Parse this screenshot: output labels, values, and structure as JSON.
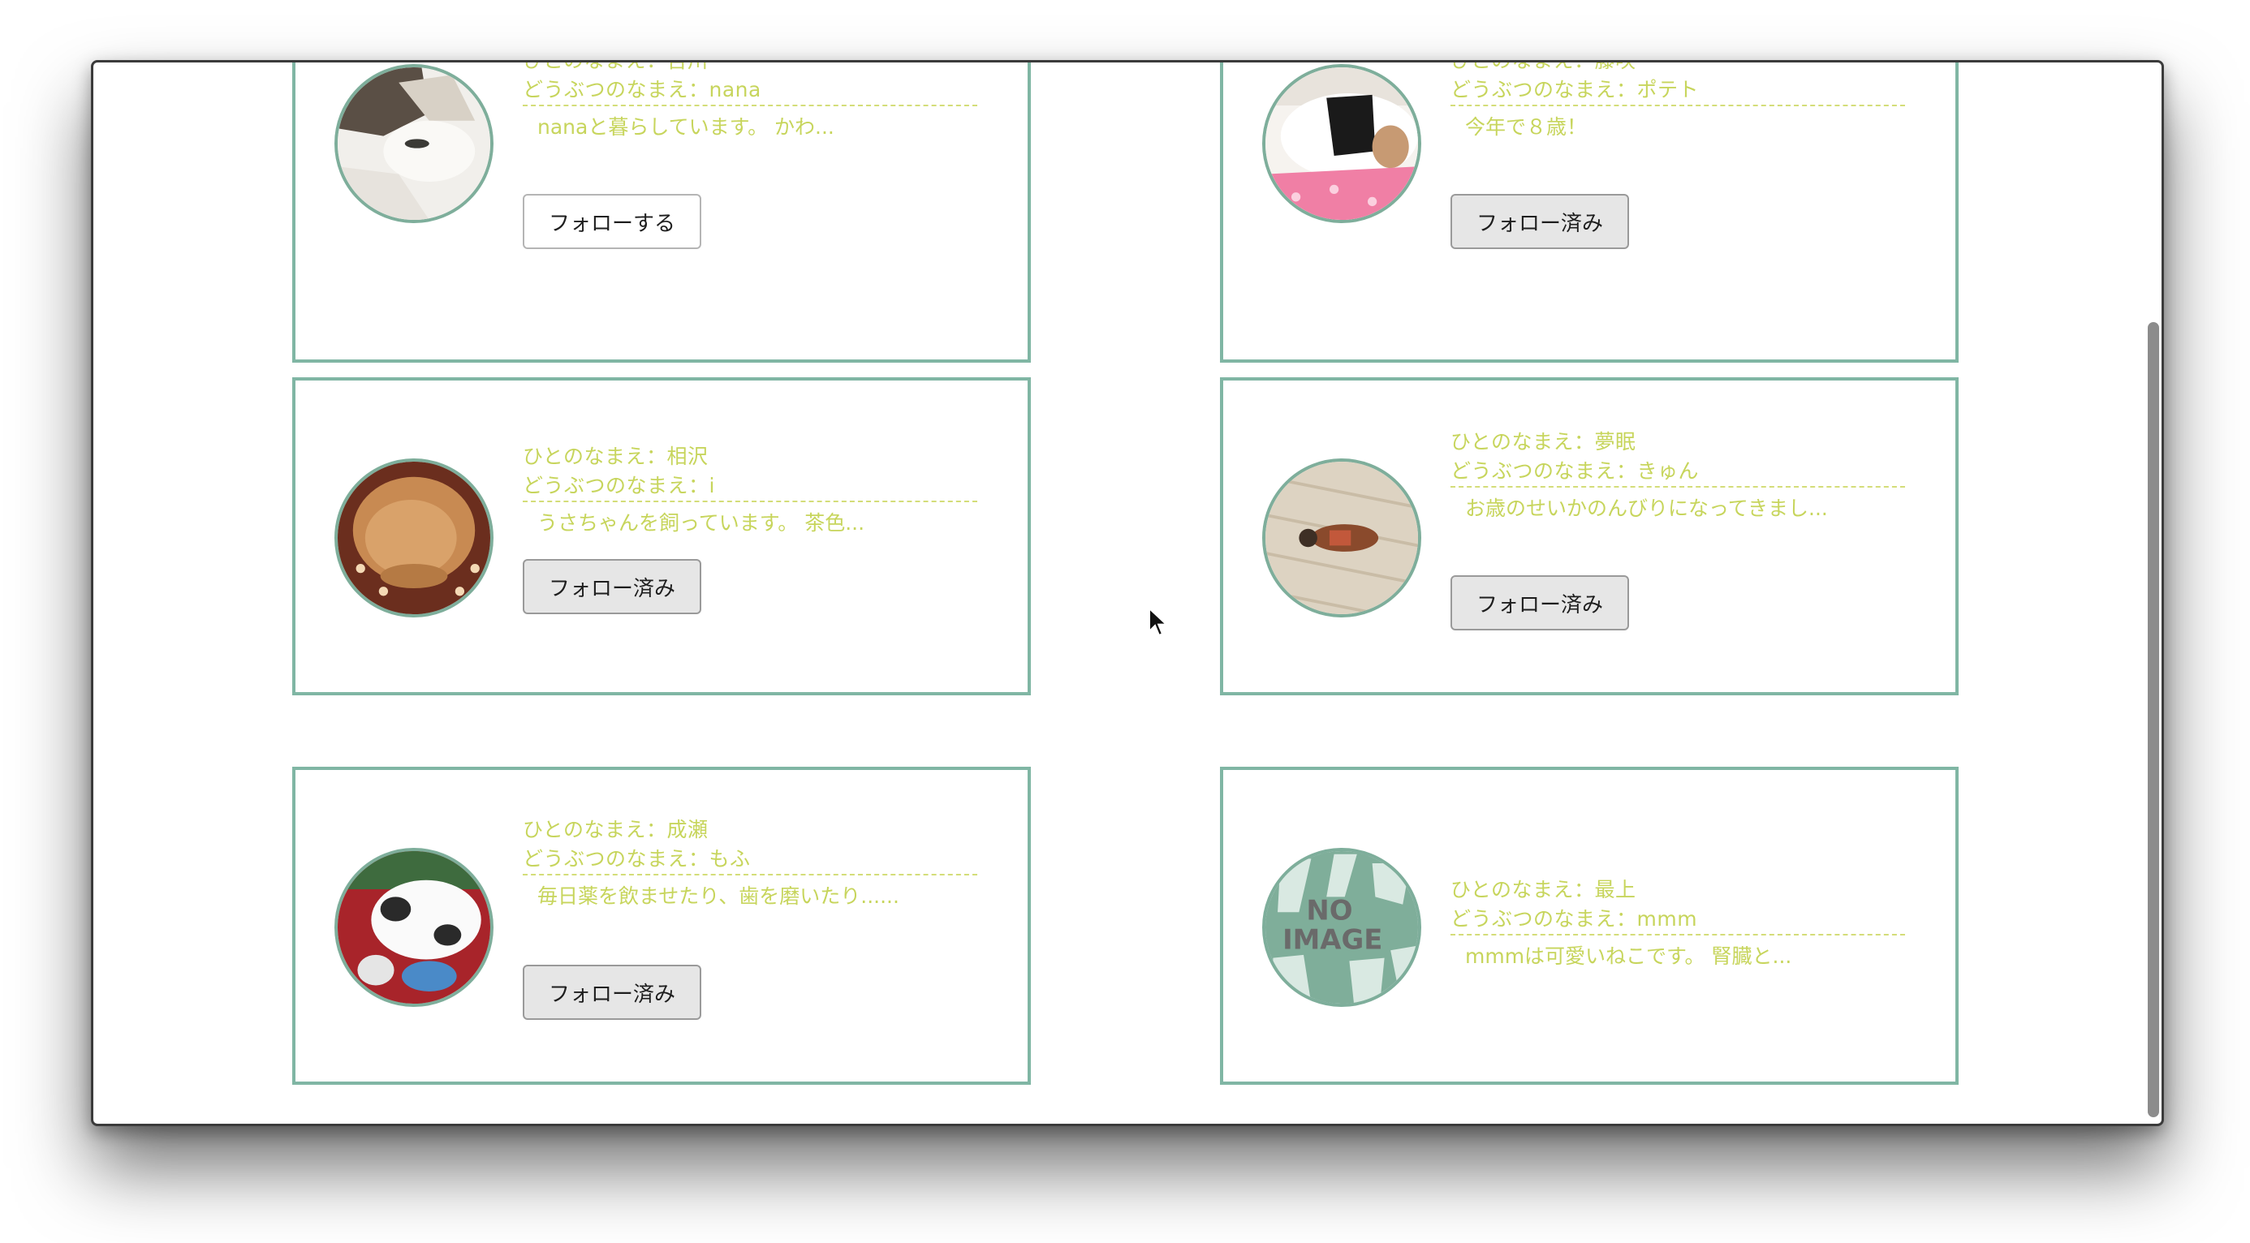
{
  "cards": [
    {
      "human_name": "ひとのなまえ：吉川",
      "pet_name": "どうぶつのなまえ：nana",
      "description": "nanaと暮らしています。 かわ...",
      "button": "フォローする",
      "button_state": "follow"
    },
    {
      "human_name": "ひとのなまえ：藤咲",
      "pet_name": "どうぶつのなまえ：ポテト",
      "description": "今年で８歳！",
      "button": "フォロー済み",
      "button_state": "followed"
    },
    {
      "human_name": "ひとのなまえ：相沢",
      "pet_name": "どうぶつのなまえ：i",
      "description": "うさちゃんを飼っています。 茶色...",
      "button": "フォロー済み",
      "button_state": "followed"
    },
    {
      "human_name": "ひとのなまえ：夢眠",
      "pet_name": "どうぶつのなまえ：きゅん",
      "description": "お歳のせいかのんびりになってきまし...",
      "button": "フォロー済み",
      "button_state": "followed"
    },
    {
      "human_name": "ひとのなまえ：成瀬",
      "pet_name": "どうぶつのなまえ：もふ",
      "description": "毎日薬を飲ませたり、歯を磨いたり......",
      "button": "フォロー済み",
      "button_state": "followed"
    },
    {
      "human_name": "ひとのなまえ：最上",
      "pet_name": "どうぶつのなまえ：mmm",
      "description": "mmmは可愛いねこです。 腎臓と...",
      "no_image_text_1": "NO",
      "no_image_text_2": "IMAGE"
    }
  ],
  "colors": {
    "card_border": "#80b6a4",
    "text": "#c7d55c",
    "button_followed_bg": "#e6e6e6"
  }
}
